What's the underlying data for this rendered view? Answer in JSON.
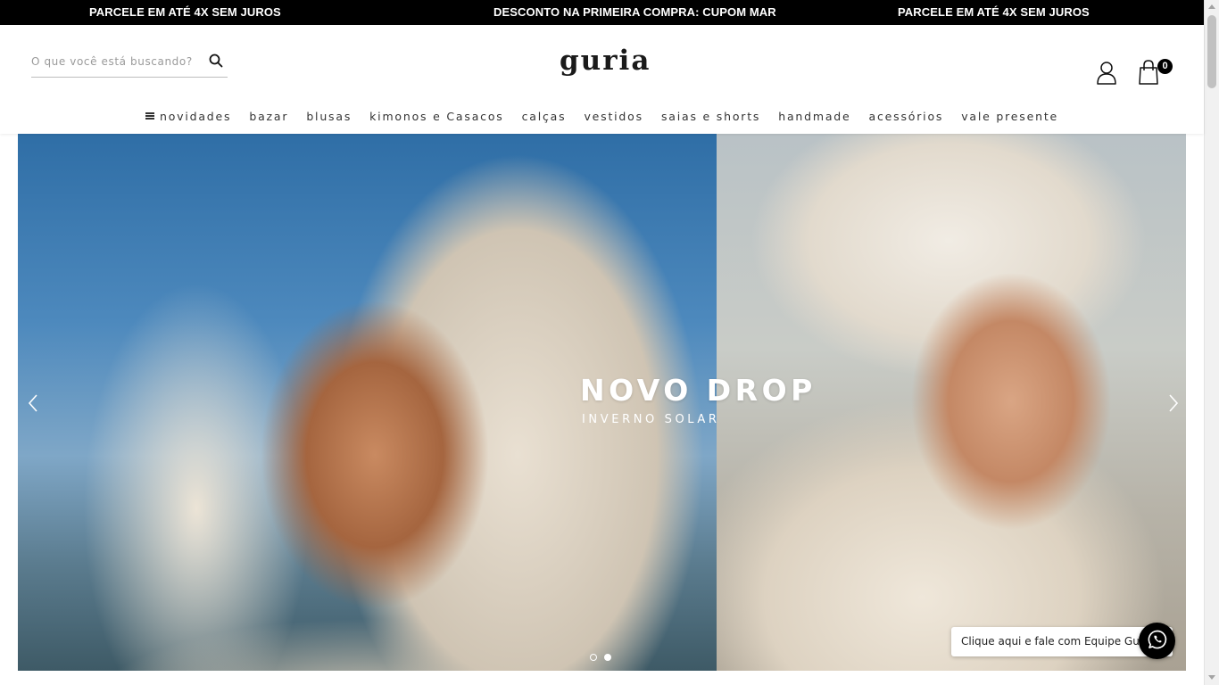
{
  "announcement_bar": {
    "items": [
      "PARCELE EM ATÉ 4X SEM JUROS",
      "DESCONTO NA PRIMEIRA COMPRA: CUPOM MAR",
      "PARCELE EM ATÉ 4X SEM JUROS"
    ],
    "background": "#000000",
    "text_color": "#ffffff"
  },
  "header": {
    "search": {
      "placeholder": "O que você está buscando?",
      "value": "",
      "icon": "search-icon"
    },
    "logo": "guria",
    "account_icon": "user-icon",
    "cart": {
      "icon": "shopping-bag-icon",
      "count": "0"
    }
  },
  "nav": {
    "menu_icon": "hamburger-icon",
    "items": [
      "novidades",
      "bazar",
      "blusas",
      "kimonos e Casacos",
      "calças",
      "vestidos",
      "saias e shorts",
      "handmade",
      "acessórios",
      "vale presente"
    ]
  },
  "hero": {
    "title": "NOVO DROP",
    "subtitle": "INVERNO SOLAR",
    "prev_icon": "chevron-left-icon",
    "next_icon": "chevron-right-icon",
    "slides_total": 2,
    "active_slide": 2
  },
  "whatsapp": {
    "label": "Clique aqui e fale com Equipe Guria",
    "icon": "whatsapp-icon"
  }
}
